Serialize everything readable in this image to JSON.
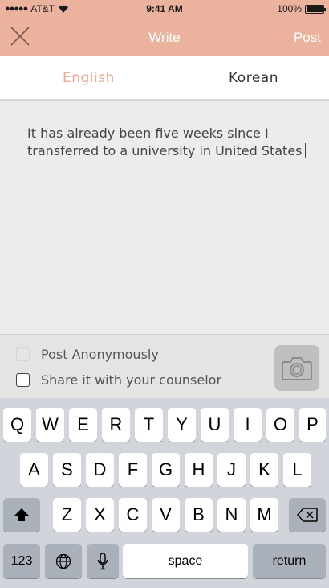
{
  "status_bar": {
    "carrier": "AT&T",
    "signal_dots": "●●●●●",
    "time": "9:41 AM",
    "battery": "100%"
  },
  "nav": {
    "title": "Write",
    "post": "Post",
    "close_icon": "close-x-icon"
  },
  "tabs": [
    {
      "label": "English",
      "active": true
    },
    {
      "label": "Korean",
      "active": false
    }
  ],
  "editor": {
    "text": "It has already been five weeks since I transferred to a university in United States"
  },
  "options": {
    "anonymous": "Post Anonymously",
    "share": "Share it with your counselor",
    "camera_icon": "camera-icon"
  },
  "keyboard": {
    "row1": [
      "Q",
      "W",
      "E",
      "R",
      "T",
      "Y",
      "U",
      "I",
      "O",
      "P"
    ],
    "row2": [
      "A",
      "S",
      "D",
      "F",
      "G",
      "H",
      "J",
      "K",
      "L"
    ],
    "row3": [
      "Z",
      "X",
      "C",
      "V",
      "B",
      "N",
      "M"
    ],
    "numbers": "123",
    "space": "space",
    "return": "return",
    "shift_icon": "shift-arrow-icon",
    "delete_icon": "backspace-icon",
    "globe_icon": "globe-icon",
    "mic_icon": "microphone-icon"
  },
  "colors": {
    "header": "#ebb29e",
    "active_tab": "#eba791"
  }
}
